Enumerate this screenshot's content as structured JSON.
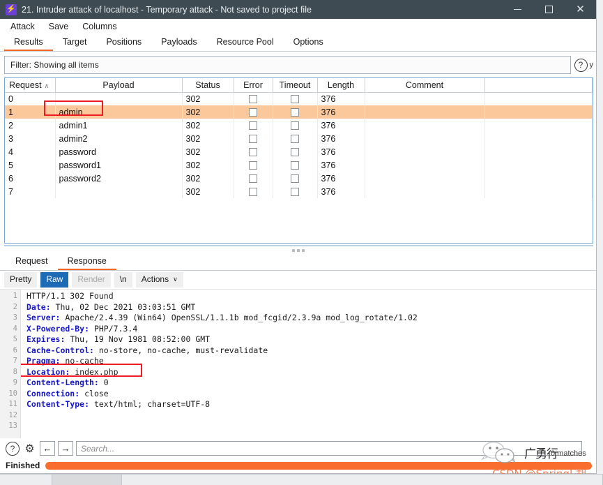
{
  "window": {
    "title": "21. Intruder attack of localhost - Temporary attack - Not saved to project file",
    "app_icon": "⚡",
    "minimize": "─",
    "maximize": "□",
    "close": "✕"
  },
  "menubar": {
    "items": [
      {
        "label": "Attack"
      },
      {
        "label": "Save"
      },
      {
        "label": "Columns"
      }
    ]
  },
  "main_tabs": {
    "items": [
      {
        "label": "Results",
        "active": true
      },
      {
        "label": "Target",
        "active": false
      },
      {
        "label": "Positions",
        "active": false
      },
      {
        "label": "Payloads",
        "active": false
      },
      {
        "label": "Resource Pool",
        "active": false
      },
      {
        "label": "Options",
        "active": false
      }
    ]
  },
  "filter": {
    "text": "Filter: Showing all items",
    "help_glyph": "?",
    "edge_letter": "y"
  },
  "results_table": {
    "columns": [
      {
        "label": "Request",
        "sorted": true,
        "sort_glyph": "∧"
      },
      {
        "label": "Payload"
      },
      {
        "label": "Status"
      },
      {
        "label": "Error"
      },
      {
        "label": "Timeout"
      },
      {
        "label": "Length"
      },
      {
        "label": "Comment"
      },
      {
        "label": ""
      }
    ],
    "rows": [
      {
        "request": "0",
        "payload": "",
        "status": "302",
        "error": false,
        "timeout": false,
        "length": "376",
        "comment": "",
        "selected": false
      },
      {
        "request": "1",
        "payload": "admin",
        "status": "302",
        "error": false,
        "timeout": false,
        "length": "376",
        "comment": "",
        "selected": true
      },
      {
        "request": "2",
        "payload": "admin1",
        "status": "302",
        "error": false,
        "timeout": false,
        "length": "376",
        "comment": "",
        "selected": false
      },
      {
        "request": "3",
        "payload": "admin2",
        "status": "302",
        "error": false,
        "timeout": false,
        "length": "376",
        "comment": "",
        "selected": false
      },
      {
        "request": "4",
        "payload": "password",
        "status": "302",
        "error": false,
        "timeout": false,
        "length": "376",
        "comment": "",
        "selected": false
      },
      {
        "request": "5",
        "payload": "password1",
        "status": "302",
        "error": false,
        "timeout": false,
        "length": "376",
        "comment": "",
        "selected": false
      },
      {
        "request": "6",
        "payload": "password2",
        "status": "302",
        "error": false,
        "timeout": false,
        "length": "376",
        "comment": "",
        "selected": false
      },
      {
        "request": "7",
        "payload": "",
        "status": "302",
        "error": false,
        "timeout": false,
        "length": "376",
        "comment": "",
        "selected": false
      }
    ]
  },
  "detail_tabs": {
    "items": [
      {
        "label": "Request",
        "active": false
      },
      {
        "label": "Response",
        "active": true
      }
    ]
  },
  "view_toolbar": {
    "pretty": "Pretty",
    "raw": "Raw",
    "render": "Render",
    "newline": "\\n",
    "actions": "Actions",
    "actions_caret": "∨"
  },
  "response": {
    "line_numbers": [
      "1",
      "2",
      "3",
      "4",
      "5",
      "6",
      "7",
      "8",
      "9",
      "10",
      "11",
      "12",
      "13"
    ],
    "lines": [
      {
        "name": "",
        "value": "HTTP/1.1 302 Found"
      },
      {
        "name": "Date:",
        "value": " Thu, 02 Dec 2021 03:03:51 GMT"
      },
      {
        "name": "Server:",
        "value": " Apache/2.4.39 (Win64) OpenSSL/1.1.1b mod_fcgid/2.3.9a mod_log_rotate/1.02"
      },
      {
        "name": "X-Powered-By:",
        "value": " PHP/7.3.4"
      },
      {
        "name": "Expires:",
        "value": " Thu, 19 Nov 1981 08:52:00 GMT"
      },
      {
        "name": "Cache-Control:",
        "value": " no-store, no-cache, must-revalidate"
      },
      {
        "name": "Pragma:",
        "value": " no-cache"
      },
      {
        "name": "Location:",
        "value": " index.php"
      },
      {
        "name": "Content-Length:",
        "value": " 0"
      },
      {
        "name": "Connection:",
        "value": " close"
      },
      {
        "name": "Content-Type:",
        "value": " text/html; charset=UTF-8"
      },
      {
        "name": "",
        "value": ""
      },
      {
        "name": "",
        "value": ""
      }
    ]
  },
  "search_bar": {
    "help_glyph": "?",
    "gear_glyph": "⚙",
    "prev_glyph": "←",
    "next_glyph": "→",
    "placeholder": "Search...",
    "value": "",
    "matches": "0 matches"
  },
  "status_bar": {
    "label": "Finished",
    "progress_percent": 100,
    "progress_color": "#f96e2e"
  },
  "watermark": {
    "wechat_icon": "wechat-icon",
    "cn_text": "广勇行",
    "csdn_text": "CSDN @SpringI 胡"
  },
  "colors": {
    "accent": "#f26522",
    "selection": "#fac89a",
    "highlight_box": "#ed1c24",
    "titlebar": "#3f4b52",
    "header_blue": "#1818c8"
  }
}
